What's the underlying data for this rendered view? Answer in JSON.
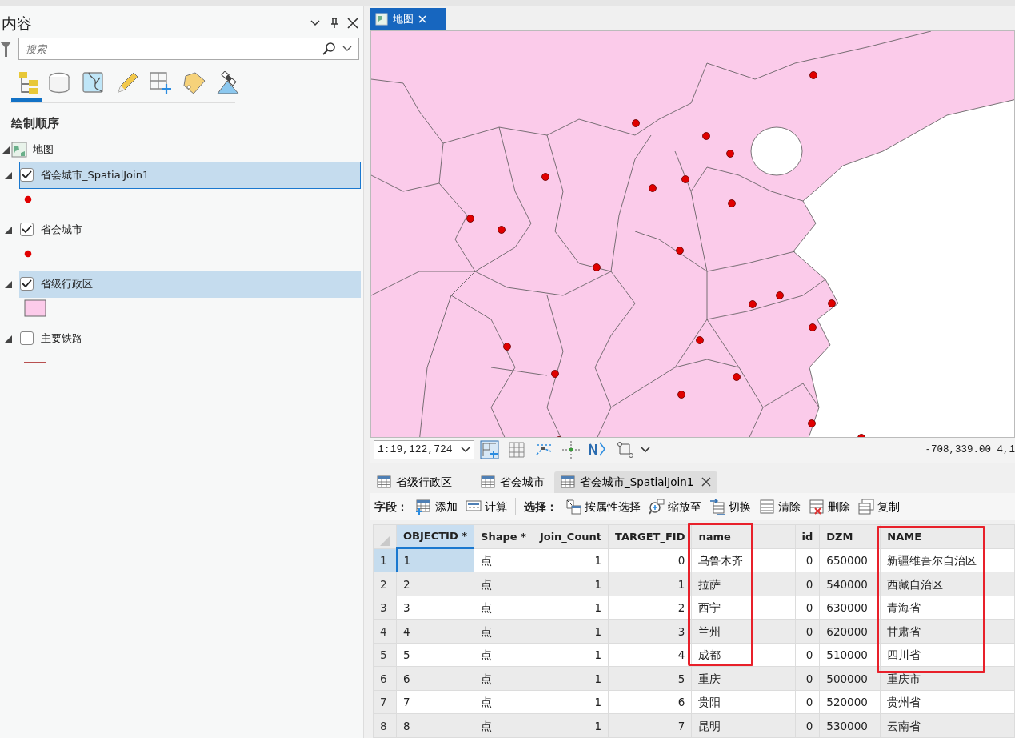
{
  "contents_pane": {
    "title": "内容",
    "search": {
      "placeholder": "搜索"
    },
    "section_title": "绘制顺序",
    "map_item": {
      "label": "地图",
      "expanded": true
    },
    "layers": [
      {
        "label": "省会城市_SpatialJoin1",
        "checked": true,
        "selected": true,
        "focused": true,
        "expanded": true,
        "legend": {
          "kind": "point",
          "color": "#e00000"
        }
      },
      {
        "label": "省会城市",
        "checked": true,
        "selected": false,
        "focused": false,
        "expanded": true,
        "legend": {
          "kind": "point",
          "color": "#e00000"
        }
      },
      {
        "label": "省级行政区",
        "checked": true,
        "selected": true,
        "focused": false,
        "expanded": true,
        "legend": {
          "kind": "polygon",
          "color": "#fccbea"
        }
      },
      {
        "label": "主要铁路",
        "checked": false,
        "selected": false,
        "focused": false,
        "expanded": true,
        "legend": {
          "kind": "line",
          "color": "#b85050"
        }
      }
    ]
  },
  "map_view": {
    "tab": {
      "label": "地图",
      "selected": true
    },
    "scale": "1:19,122,724",
    "coordinates": "-708,339.00 4,1"
  },
  "table_view": {
    "tabs": [
      {
        "label": "省级行政区",
        "selected": false
      },
      {
        "label": "省会城市",
        "selected": false
      },
      {
        "label": "省会城市_SpatialJoin1",
        "selected": true
      }
    ],
    "toolbar": {
      "field_label": "字段：",
      "field_buttons": [
        "添加",
        "计算"
      ],
      "select_label": "选择：",
      "select_buttons": [
        "按属性选择",
        "缩放至",
        "切换",
        "清除",
        "删除",
        "复制"
      ]
    },
    "columns": [
      {
        "label": "OBJECTID *",
        "numeric": false,
        "annotated": false
      },
      {
        "label": "Shape *",
        "numeric": false,
        "annotated": false
      },
      {
        "label": "Join_Count",
        "numeric": true,
        "annotated": false
      },
      {
        "label": "TARGET_FID",
        "numeric": true,
        "annotated": false
      },
      {
        "label": "name",
        "numeric": false,
        "annotated": true
      },
      {
        "label": "id",
        "numeric": true,
        "annotated": false
      },
      {
        "label": "DZM",
        "numeric": false,
        "annotated": false
      },
      {
        "label": "NAME",
        "numeric": false,
        "annotated": true
      }
    ],
    "rows": [
      {
        "number": "1",
        "selected": true,
        "cells": [
          "1",
          "点",
          "1",
          "0",
          "乌鲁木齐",
          "0",
          "650000",
          "新疆维吾尔自治区"
        ]
      },
      {
        "number": "2",
        "selected": false,
        "cells": [
          "2",
          "点",
          "1",
          "1",
          "拉萨",
          "0",
          "540000",
          "西藏自治区"
        ]
      },
      {
        "number": "3",
        "selected": false,
        "cells": [
          "3",
          "点",
          "1",
          "2",
          "西宁",
          "0",
          "630000",
          "青海省"
        ]
      },
      {
        "number": "4",
        "selected": false,
        "cells": [
          "4",
          "点",
          "1",
          "3",
          "兰州",
          "0",
          "620000",
          "甘肃省"
        ]
      },
      {
        "number": "5",
        "selected": false,
        "cells": [
          "5",
          "点",
          "1",
          "4",
          "成都",
          "0",
          "510000",
          "四川省"
        ]
      },
      {
        "number": "6",
        "selected": false,
        "cells": [
          "6",
          "点",
          "1",
          "5",
          "重庆",
          "0",
          "500000",
          "重庆市"
        ]
      },
      {
        "number": "7",
        "selected": false,
        "cells": [
          "7",
          "点",
          "1",
          "6",
          "贵阳",
          "0",
          "520000",
          "贵州省"
        ]
      },
      {
        "number": "8",
        "selected": false,
        "cells": [
          "8",
          "点",
          "1",
          "7",
          "昆明",
          "0",
          "530000",
          "云南省"
        ]
      }
    ]
  }
}
